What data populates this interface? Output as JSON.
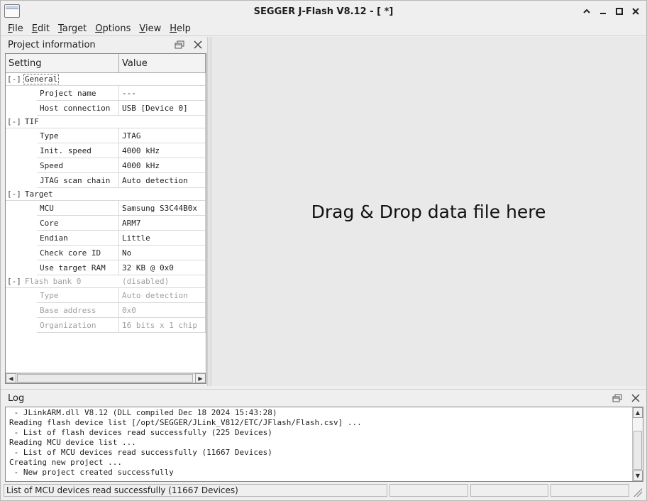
{
  "window": {
    "title": "SEGGER J-Flash V8.12 - [ *]"
  },
  "menu": [
    {
      "u": "F",
      "rest": "ile"
    },
    {
      "u": "E",
      "rest": "dit"
    },
    {
      "u": "T",
      "rest": "arget"
    },
    {
      "u": "O",
      "rest": "ptions"
    },
    {
      "u": "V",
      "rest": "iew"
    },
    {
      "u": "H",
      "rest": "elp"
    }
  ],
  "project_panel": {
    "title": "Project information",
    "columns": {
      "setting": "Setting",
      "value": "Value"
    },
    "toggle": "[-]",
    "groups": [
      {
        "label": "General",
        "value": "",
        "disabled": false,
        "items": [
          {
            "setting": "Project name",
            "value": "---"
          },
          {
            "setting": "Host connection",
            "value": "USB [Device 0]"
          }
        ]
      },
      {
        "label": "TIF",
        "value": "",
        "disabled": false,
        "items": [
          {
            "setting": "Type",
            "value": "JTAG"
          },
          {
            "setting": "Init. speed",
            "value": "4000 kHz"
          },
          {
            "setting": "Speed",
            "value": "4000 kHz"
          },
          {
            "setting": "JTAG scan chain",
            "value": "Auto detection"
          }
        ]
      },
      {
        "label": "Target",
        "value": "",
        "disabled": false,
        "items": [
          {
            "setting": "MCU",
            "value": "Samsung S3C44B0x"
          },
          {
            "setting": "Core",
            "value": "ARM7"
          },
          {
            "setting": "Endian",
            "value": "Little"
          },
          {
            "setting": "Check core ID",
            "value": "No"
          },
          {
            "setting": "Use target RAM",
            "value": "32 KB @ 0x0"
          }
        ]
      },
      {
        "label": "Flash bank 0",
        "value": "(disabled)",
        "disabled": true,
        "items": [
          {
            "setting": "Type",
            "value": "Auto detection"
          },
          {
            "setting": "Base address",
            "value": "0x0"
          },
          {
            "setting": "Organization",
            "value": "16 bits x 1 chip"
          }
        ]
      }
    ]
  },
  "drop_area": {
    "text": "Drag & Drop data file here"
  },
  "log_panel": {
    "title": "Log",
    "lines": [
      " - JLinkARM.dll V8.12 (DLL compiled Dec 18 2024 15:43:28)",
      "Reading flash device list [/opt/SEGGER/JLink_V812/ETC/JFlash/Flash.csv] ...",
      " - List of flash devices read successfully (225 Devices)",
      "Reading MCU device list ...",
      " - List of MCU devices read successfully (11667 Devices)",
      "Creating new project ...",
      " - New project created successfully"
    ]
  },
  "statusbar": {
    "message": "List of MCU devices read successfully (11667 Devices)"
  }
}
